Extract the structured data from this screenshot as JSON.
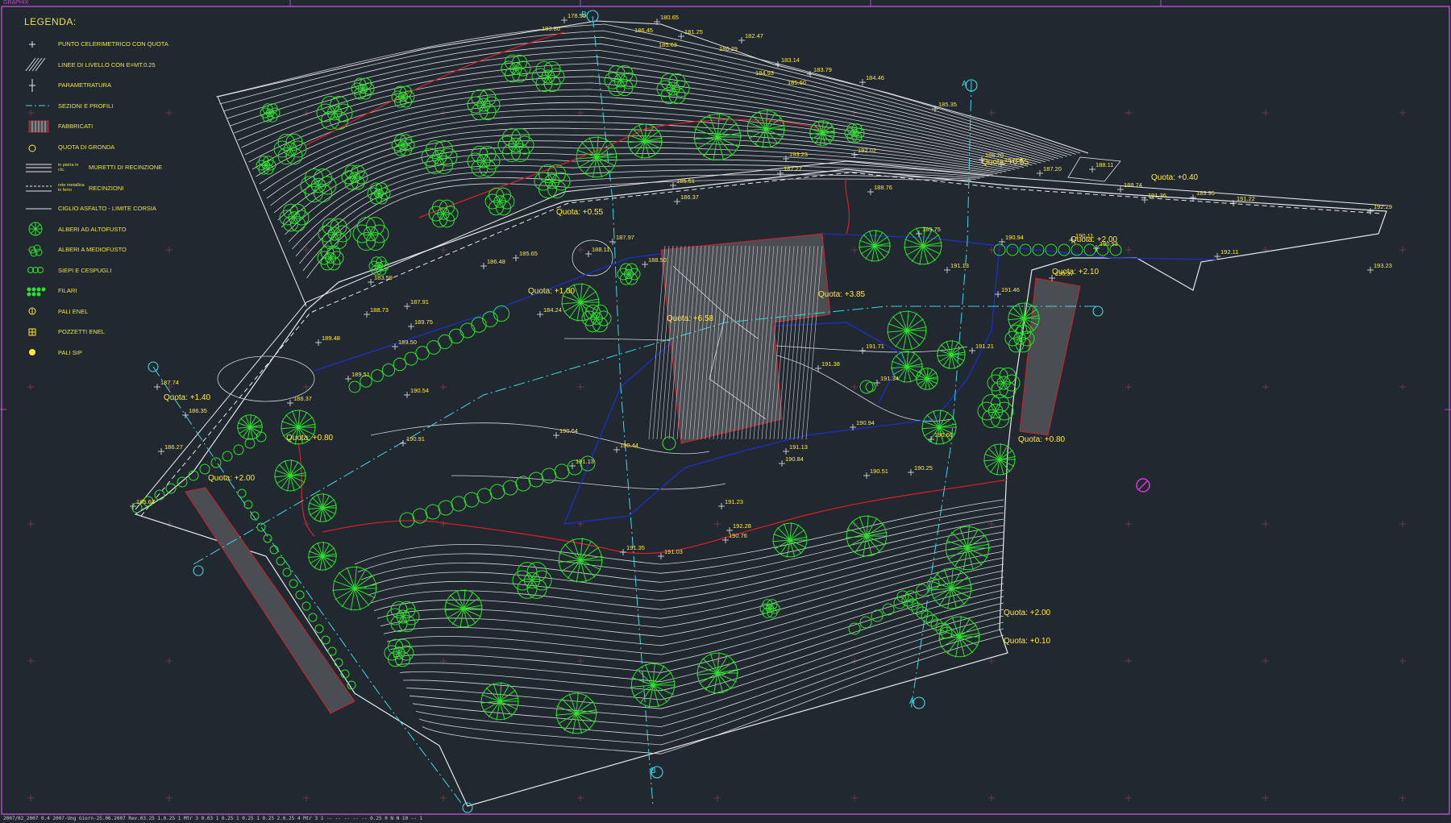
{
  "window": {
    "title_tag": "GRAPHIX"
  },
  "legend": {
    "title": "LEGENDA:",
    "items": [
      {
        "label": "PUNTO CELERIMETRICO CON QUOTA",
        "icon": "survey-point-icon"
      },
      {
        "label": "LINEE DI LIVELLO CON E=MT.0.25",
        "icon": "contour-lines-icon"
      },
      {
        "label": "PARAMETRATURA",
        "icon": "parameter-icon"
      },
      {
        "label": "SEZIONI E PROFILI",
        "icon": "section-line-icon"
      },
      {
        "label": "FABBRICATI",
        "icon": "building-hatch-icon"
      },
      {
        "label": "QUOTA DI GRONDA",
        "icon": "eave-elevation-icon"
      },
      {
        "label": "MURETTI DI RECINZIONE",
        "prefix": "in pietra in cls.",
        "icon": "fence-wall-icon"
      },
      {
        "label": "RECINZIONI",
        "prefix": "rete metallica in ferro",
        "icon": "fence-mesh-icon"
      },
      {
        "label": "CIGLIO ASFALTO - LIMITE CORSIA",
        "icon": "road-edge-icon"
      },
      {
        "label": "ALBERI AD ALTOFUSTO",
        "icon": "tall-tree-icon"
      },
      {
        "label": "ALBERI A MEDIOFUSTO",
        "icon": "medium-tree-icon"
      },
      {
        "label": "SIEPI E CESPUGLI",
        "icon": "hedge-icon"
      },
      {
        "label": "FILARI",
        "icon": "tree-row-icon"
      },
      {
        "label": "PALI ENEL",
        "icon": "enel-pole-icon"
      },
      {
        "label": "POZZETTI ENEL",
        "icon": "enel-manhole-icon"
      },
      {
        "label": "PALI SIP",
        "icon": "sip-pole-icon"
      }
    ]
  },
  "quotas": [
    {
      "text": "Quota: +0.55",
      "id": "q1"
    },
    {
      "text": "Quota: +0.40",
      "id": "q2"
    },
    {
      "text": "Quota: +0.55",
      "id": "q3"
    },
    {
      "text": "Quota: +1.00",
      "id": "q4"
    },
    {
      "text": "Quota: +2.00",
      "id": "q5"
    },
    {
      "text": "Quota: +2.10",
      "id": "q6"
    },
    {
      "text": "Quota: +6.58",
      "id": "q7"
    },
    {
      "text": "Quota: +3.85",
      "id": "q8"
    },
    {
      "text": "Quota: +1.40",
      "id": "q9"
    },
    {
      "text": "Quota: +0.80",
      "id": "q10"
    },
    {
      "text": "Quota: +2.00",
      "id": "q11"
    },
    {
      "text": "Quota: +0.80",
      "id": "q12"
    },
    {
      "text": "Quota: +2.00",
      "id": "q13"
    },
    {
      "text": "Quota: +0.10",
      "id": "q14"
    }
  ],
  "sections": [
    {
      "text": "B",
      "id": "sb1"
    },
    {
      "text": "A",
      "id": "sa1"
    },
    {
      "text": "B",
      "id": "sb2"
    },
    {
      "text": "A",
      "id": "sa2"
    }
  ],
  "elevations": [
    {
      "text": "178.55"
    },
    {
      "text": "180.65"
    },
    {
      "text": "181.25"
    },
    {
      "text": "182.47"
    },
    {
      "text": "183.14"
    },
    {
      "text": "183.79"
    },
    {
      "text": "184.46"
    },
    {
      "text": "185.35"
    },
    {
      "text": "186.20"
    },
    {
      "text": "187.06"
    },
    {
      "text": "187.20"
    },
    {
      "text": "188.11"
    },
    {
      "text": "188.74"
    },
    {
      "text": "189.95"
    },
    {
      "text": "191.36"
    },
    {
      "text": "191.22"
    },
    {
      "text": "192.29"
    },
    {
      "text": "192.11"
    },
    {
      "text": "193.23"
    },
    {
      "text": "192.02"
    },
    {
      "text": "193.23"
    },
    {
      "text": "185.51"
    },
    {
      "text": "186.37"
    },
    {
      "text": "187.27"
    },
    {
      "text": "188.76"
    },
    {
      "text": "189.75"
    },
    {
      "text": "190.94"
    },
    {
      "text": "190.11"
    },
    {
      "text": "190.53"
    },
    {
      "text": "190.37"
    },
    {
      "text": "191.13"
    },
    {
      "text": "191.46"
    },
    {
      "text": "191.21"
    },
    {
      "text": "191.34"
    },
    {
      "text": "191.71"
    },
    {
      "text": "191.38"
    },
    {
      "text": "190.94"
    },
    {
      "text": "191.13"
    },
    {
      "text": "190.84"
    },
    {
      "text": "190.51"
    },
    {
      "text": "190.25"
    },
    {
      "text": "190.66"
    },
    {
      "text": "191.23"
    },
    {
      "text": "192.28"
    },
    {
      "text": "191.03"
    },
    {
      "text": "190.76"
    },
    {
      "text": "191.35"
    },
    {
      "text": "190.44"
    },
    {
      "text": "191.13"
    },
    {
      "text": "190.64"
    },
    {
      "text": "190.91"
    },
    {
      "text": "190.54"
    },
    {
      "text": "189.50"
    },
    {
      "text": "189.75"
    },
    {
      "text": "189.51"
    },
    {
      "text": "189.48"
    },
    {
      "text": "188.73"
    },
    {
      "text": "188.37"
    },
    {
      "text": "186.35"
    },
    {
      "text": "186.27"
    },
    {
      "text": "185.62"
    },
    {
      "text": "187.74"
    },
    {
      "text": "186.48"
    },
    {
      "text": "185.65"
    },
    {
      "text": "187.97"
    },
    {
      "text": "188.50"
    },
    {
      "text": "188.11"
    },
    {
      "text": "187.91"
    },
    {
      "text": "184.24"
    },
    {
      "text": "183.59"
    },
    {
      "text": "183.80"
    },
    {
      "text": "186.45"
    },
    {
      "text": "185.63"
    },
    {
      "text": "186.29"
    },
    {
      "text": "184.93"
    },
    {
      "text": "185.60"
    }
  ],
  "bottom_bar": {
    "text": "2007/02_2007 0.4 2007-Ung Giorn-25.06.2007 Rev.03.25 1.0.25 1 Mtr 3 0.03 1 0.25 1 0.25 1 0.25 2.0.25 4 Mtr 3 1 -- -- -- -- -- 0.25 0 N N 10 -- 1"
  },
  "colors": {
    "background": "#212830",
    "contour": "#d4d6da",
    "tree": "#2de02d",
    "label": "#ffe93a",
    "section": "#3fd6e0",
    "boundary": "#1a2ec8",
    "red_line": "#d11f2a",
    "frame": "#b54ac4"
  }
}
